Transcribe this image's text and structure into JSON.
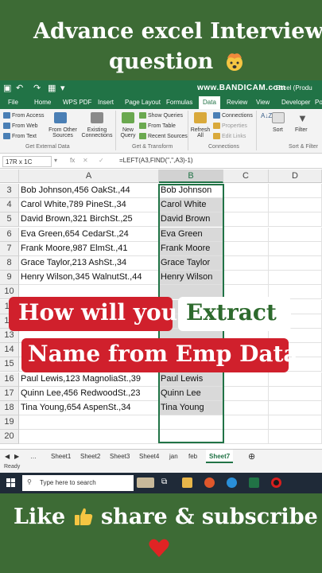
{
  "header": {
    "line1": "Advance excel Interview",
    "line2": "question"
  },
  "excel": {
    "watermark": "www.BANDICAM.com",
    "window_title": "- Excel (Produ",
    "menu": [
      "File",
      "Home",
      "WPS PDF",
      "Insert",
      "Page Layout",
      "Formulas",
      "Data",
      "Review",
      "View",
      "Developer",
      "Pow"
    ],
    "active_menu": "Data",
    "ribbon": {
      "get_external": [
        "From Access",
        "From Web",
        "From Text"
      ],
      "from_other": "From Other Sources",
      "existing": "Existing Connections",
      "new_query": "New Query",
      "show_queries": "Show Queries",
      "from_table": "From Table",
      "recent_sources": "Recent Sources",
      "refresh_all": "Refresh All",
      "connections": "Connections",
      "properties": "Properties",
      "edit_links": "Edit Links",
      "sort": "Sort",
      "filter": "Filter",
      "group_get_external": "Get External Data",
      "group_get_transform": "Get & Transform",
      "group_connections": "Connections",
      "group_sort_filter": "Sort & Filter"
    },
    "formula_bar": {
      "name_box": "17R x 1C",
      "fx": "fx",
      "formula": "=LEFT(A3,FIND(\",\",A3)-1)"
    },
    "columns": [
      "A",
      "B",
      "C",
      "D"
    ],
    "rows": [
      {
        "num": "3",
        "a": "Bob Johnson,456 OakSt.,44",
        "b": "Bob Johnson"
      },
      {
        "num": "4",
        "a": "Carol White,789 PineSt.,34",
        "b": "Carol White"
      },
      {
        "num": "5",
        "a": "David Brown,321 BirchSt.,25",
        "b": "David Brown"
      },
      {
        "num": "6",
        "a": "Eva Green,654 CedarSt.,24",
        "b": "Eva Green"
      },
      {
        "num": "7",
        "a": "Frank Moore,987 ElmSt.,41",
        "b": "Frank Moore"
      },
      {
        "num": "8",
        "a": "Grace Taylor,213 AshSt.,34",
        "b": "Grace Taylor"
      },
      {
        "num": "9",
        "a": "Henry Wilson,345 WalnutSt.,44",
        "b": "Henry Wilson"
      },
      {
        "num": "10",
        "a": "",
        "b": ""
      },
      {
        "num": "11",
        "a": "",
        "b": ""
      },
      {
        "num": "12",
        "a": "",
        "b": ""
      },
      {
        "num": "13",
        "a": "",
        "b": ""
      },
      {
        "num": "14",
        "a": "",
        "b": ""
      },
      {
        "num": "15",
        "a": "",
        "b": ""
      },
      {
        "num": "16",
        "a": "Paul Lewis,123 MagnoliaSt.,39",
        "b": "Paul Lewis"
      },
      {
        "num": "17",
        "a": "Quinn Lee,456 RedwoodSt.,23",
        "b": "Quinn Lee"
      },
      {
        "num": "18",
        "a": "Tina Young,654 AspenSt.,34",
        "b": "Tina Young"
      },
      {
        "num": "19",
        "a": "",
        "b": ""
      },
      {
        "num": "20",
        "a": "",
        "b": ""
      }
    ],
    "sheets": [
      "Sheet1",
      "Sheet2",
      "Sheet3",
      "Sheet4",
      "jan",
      "feb",
      "Sheet7"
    ],
    "active_sheet": "Sheet7",
    "status": "Ready"
  },
  "overlay": {
    "part1": "How will you",
    "part2": "Extract",
    "part3": "Name from Emp Data"
  },
  "taskbar": {
    "search_placeholder": "Type here to search"
  },
  "footer": {
    "text_before": "Like",
    "text_after": "share & subscribe"
  },
  "colors": {
    "background_green": "#3d6b35",
    "excel_green": "#217346",
    "overlay_red": "#d0202c",
    "overlay_green_text": "#2d6a2d"
  }
}
